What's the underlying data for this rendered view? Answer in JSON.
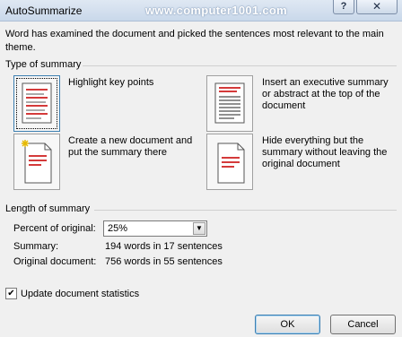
{
  "window": {
    "title": "AutoSummarize",
    "watermark": "www.computer1001.com",
    "help_label": "?",
    "close_label": "✕"
  },
  "description": "Word has examined the document and picked the sentences most relevant to the main theme.",
  "type_of_summary": {
    "label": "Type of summary",
    "options": [
      {
        "label": "Highlight key points",
        "selected": true,
        "icon": "highlight-doc-icon"
      },
      {
        "label": "Insert an executive summary or abstract at the top of the document",
        "selected": false,
        "icon": "executive-summary-icon"
      },
      {
        "label": "Create a new document and put the summary there",
        "selected": false,
        "icon": "new-document-icon"
      },
      {
        "label": "Hide everything but the summary without leaving the original document",
        "selected": false,
        "icon": "hide-document-icon"
      }
    ]
  },
  "length_of_summary": {
    "label": "Length of summary",
    "percent_label": "Percent of original:",
    "percent_value": "25%",
    "summary_label": "Summary:",
    "summary_value": "194 words in 17 sentences",
    "original_label": "Original document:",
    "original_value": "756 words in 55 sentences"
  },
  "update_stats": {
    "label": "Update document statistics",
    "checked": true,
    "check_glyph": "✔"
  },
  "buttons": {
    "ok": "OK",
    "cancel": "Cancel"
  },
  "colors": {
    "highlight_red": "#d43a3a",
    "selection_blue": "#3c7fb1"
  }
}
